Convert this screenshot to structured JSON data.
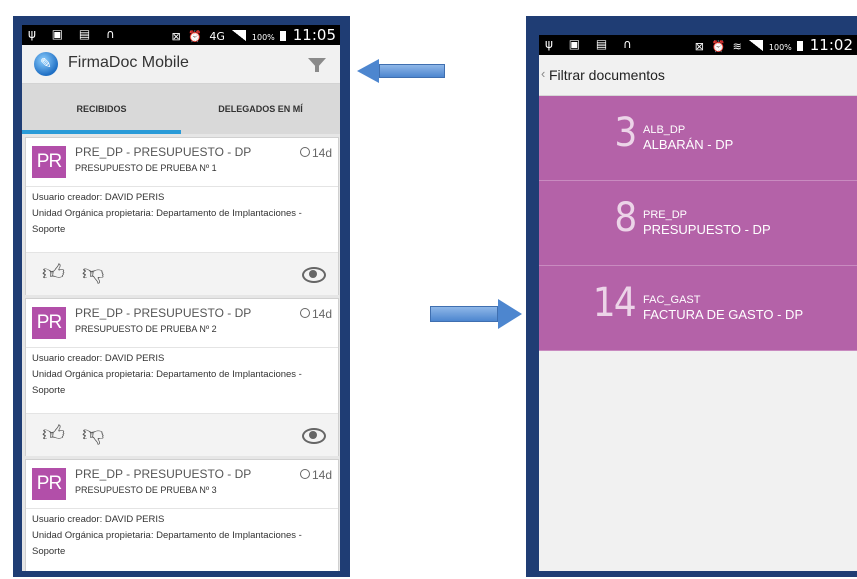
{
  "left_screen": {
    "status_bar": {
      "time": "11:05",
      "battery_pct": "100%",
      "network": "4G"
    },
    "app_bar": {
      "title": "FirmaDoc Mobile"
    },
    "tabs": [
      {
        "label": "RECIBIDOS",
        "selected": true
      },
      {
        "label": "DELEGADOS EN MÍ",
        "selected": false
      }
    ],
    "cards": [
      {
        "badge": "PR",
        "title": "PRE_DP - PRESUPUESTO - DP",
        "subtitle": "PRESUPUESTO DE PRUEBA Nº 1",
        "age": "14d",
        "creator": "Usuario creador: DAVID PERIS",
        "unit": "Unidad Orgánica propietaria: Departamento de Implantaciones - Soporte"
      },
      {
        "badge": "PR",
        "title": "PRE_DP - PRESUPUESTO - DP",
        "subtitle": "PRESUPUESTO DE PRUEBA Nº 2",
        "age": "14d",
        "creator": "Usuario creador: DAVID PERIS",
        "unit": "Unidad Orgánica propietaria: Departamento de Implantaciones - Soporte"
      },
      {
        "badge": "PR",
        "title": "PRE_DP - PRESUPUESTO - DP",
        "subtitle": "PRESUPUESTO DE PRUEBA Nº 3",
        "age": "14d",
        "creator": "Usuario creador: DAVID PERIS",
        "unit": "Unidad Orgánica propietaria: Departamento de Implantaciones - Soporte"
      }
    ]
  },
  "right_screen": {
    "status_bar": {
      "time": "11:02",
      "battery_pct": "100%"
    },
    "header": {
      "title": "Filtrar documentos"
    },
    "filters": [
      {
        "count": "3",
        "code": "ALB_DP",
        "name": "ALBARÁN - DP"
      },
      {
        "count": "8",
        "code": "PRE_DP",
        "name": "PRESUPUESTO - DP"
      },
      {
        "count": "14",
        "code": "FAC_GAST",
        "name": "FACTURA DE GASTO - DP"
      }
    ]
  },
  "colors": {
    "frame": "#1f3d74",
    "accent_tab": "#2a9bd8",
    "badge": "#b24fa9",
    "filter_item": "#b462a8",
    "arrow": "#4d86cf"
  },
  "icons": [
    "usb-icon",
    "sim-icon",
    "headset-icon",
    "alarm-icon",
    "signal-icon",
    "battery-icon",
    "filter-icon",
    "clock-icon",
    "thumbs-up-icon",
    "thumbs-down-icon",
    "eye-icon",
    "back-chevron-icon"
  ]
}
